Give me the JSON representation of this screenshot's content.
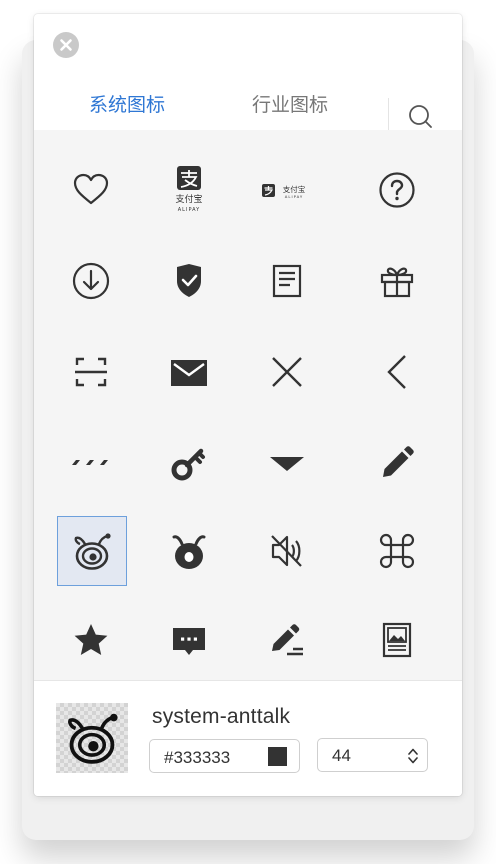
{
  "tabs": [
    {
      "label": "系统图标",
      "active": true
    },
    {
      "label": "行业图标",
      "active": false
    }
  ],
  "icons": [
    {
      "name": "heart"
    },
    {
      "name": "alipay-square"
    },
    {
      "name": "alipay-horizontal"
    },
    {
      "name": "question-circle"
    },
    {
      "name": "download-circle"
    },
    {
      "name": "shield-check"
    },
    {
      "name": "file-text"
    },
    {
      "name": "gift"
    },
    {
      "name": "scan"
    },
    {
      "name": "mail"
    },
    {
      "name": "close"
    },
    {
      "name": "left-arrow"
    },
    {
      "name": "ellipsis"
    },
    {
      "name": "key"
    },
    {
      "name": "caret-down"
    },
    {
      "name": "edit"
    },
    {
      "name": "anttalk-outline",
      "selected": true
    },
    {
      "name": "anttalk-filled"
    },
    {
      "name": "sound-off"
    },
    {
      "name": "command"
    },
    {
      "name": "star"
    },
    {
      "name": "message-dots"
    },
    {
      "name": "edit-line"
    },
    {
      "name": "picture-doc"
    }
  ],
  "alipay_text": {
    "small": "支付宝",
    "sub": "ALIPAY"
  },
  "footer": {
    "icon_name": "system-anttalk",
    "color_value": "#333333",
    "size_value": "44"
  },
  "colors": {
    "accent": "#2f77d4",
    "icon": "#333333"
  }
}
